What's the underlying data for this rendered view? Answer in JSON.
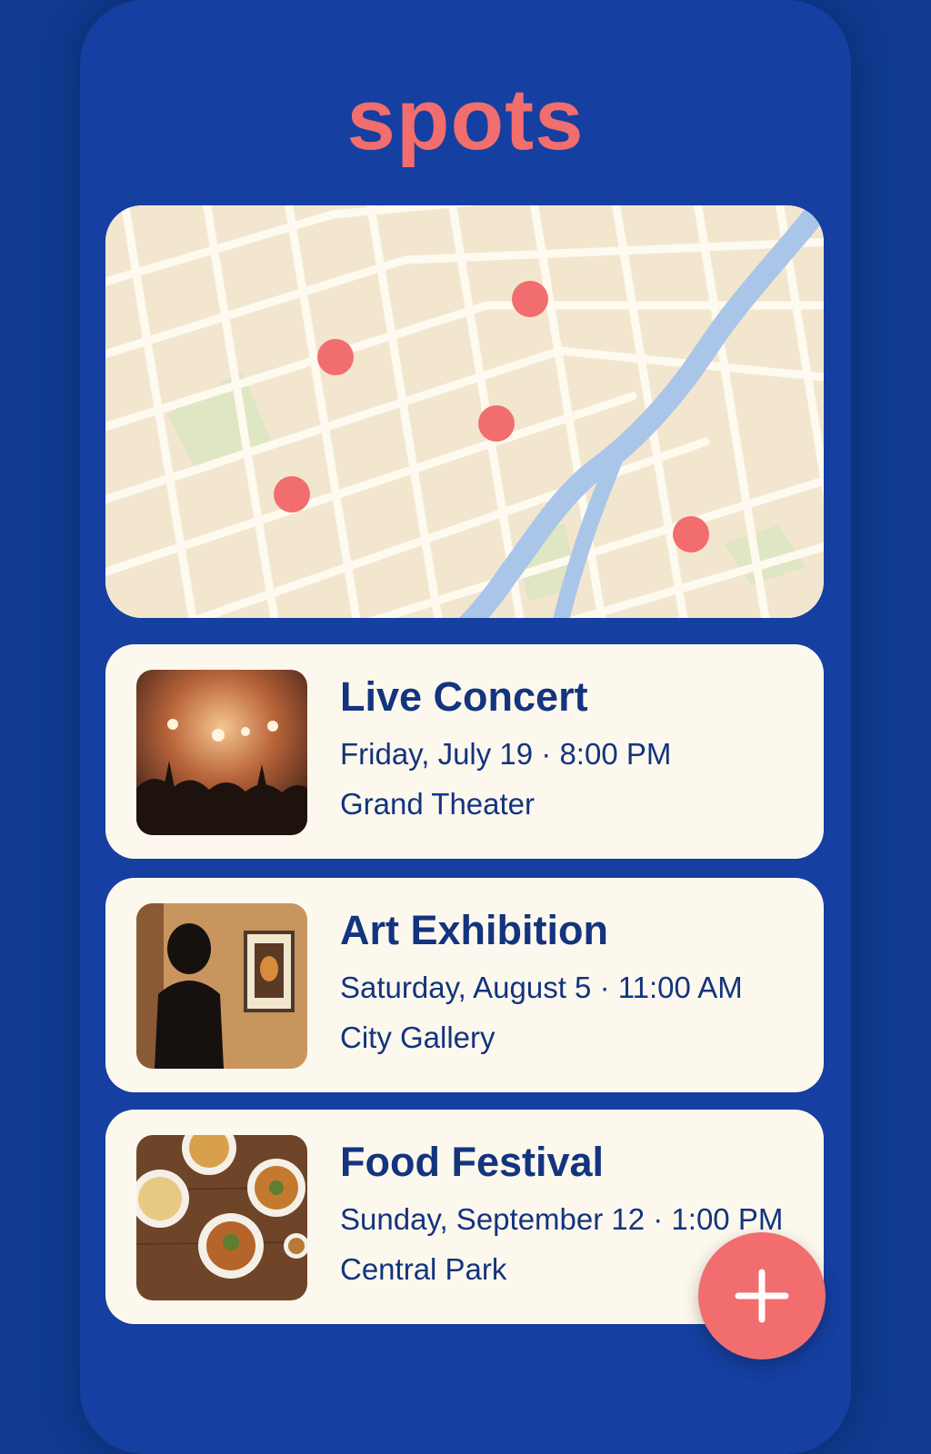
{
  "app": {
    "title": "spots"
  },
  "colors": {
    "background": "#0f3a8f",
    "panel": "#153fa0",
    "accent": "#f26d6d",
    "card": "#fdf8ee",
    "text": "#13347e",
    "map_land": "#f3e6cf",
    "map_water": "#a9c6e8",
    "map_park": "#dfe6c4"
  },
  "map": {
    "pin_count": 5
  },
  "events": [
    {
      "title": "Live Concert",
      "datetime": "Friday, July 19 · 8:00 PM",
      "venue": "Grand Theater",
      "image_icon": "concert-photo"
    },
    {
      "title": "Art Exhibition",
      "datetime": "Saturday, August 5 · 11:00 AM",
      "venue": "City Gallery",
      "image_icon": "gallery-photo"
    },
    {
      "title": "Food Festival",
      "datetime": "Sunday, September 12 · 1:00 PM",
      "venue": "Central Park",
      "image_icon": "food-photo"
    }
  ],
  "fab": {
    "icon": "plus-icon"
  }
}
